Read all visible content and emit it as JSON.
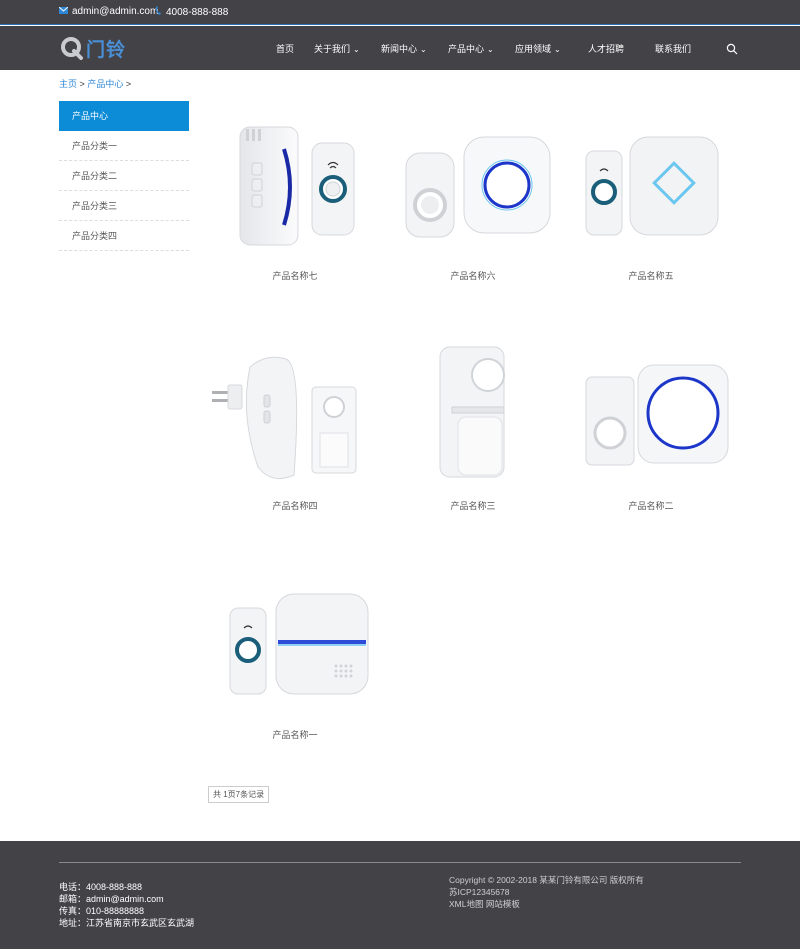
{
  "topbar": {
    "email": "admin@admin.com",
    "phone": "4008-888-888"
  },
  "logo": {
    "text": "门铃"
  },
  "nav": {
    "items": [
      {
        "label": "首页",
        "dropdown": false
      },
      {
        "label": "关于我们",
        "dropdown": true
      },
      {
        "label": "新闻中心",
        "dropdown": true
      },
      {
        "label": "产品中心",
        "dropdown": true
      },
      {
        "label": "应用领域",
        "dropdown": true
      },
      {
        "label": "人才招聘",
        "dropdown": false
      },
      {
        "label": "联系我们",
        "dropdown": false
      }
    ]
  },
  "breadcrumb": {
    "home": "主页",
    "sep": ">",
    "current": "产品中心",
    "trail_end": ">"
  },
  "sidebar": {
    "title": "产品中心",
    "items": [
      "产品分类一",
      "产品分类二",
      "产品分类三",
      "产品分类四"
    ]
  },
  "products": [
    {
      "name": "产品名称七"
    },
    {
      "name": "产品名称六"
    },
    {
      "name": "产品名称五"
    },
    {
      "name": "产品名称四"
    },
    {
      "name": "产品名称三"
    },
    {
      "name": "产品名称二"
    },
    {
      "name": "产品名称一"
    }
  ],
  "pager": {
    "text": "共 1页7条记录"
  },
  "footer": {
    "phone": "电话：4008-888-888",
    "email": "邮箱：admin@admin.com",
    "fax": "传真：010-88888888",
    "address": "地址：江苏省南京市玄武区玄武湖",
    "copyright": "Copyright © 2002-2018 某某门铃有限公司 版权所有",
    "icp": "苏ICP12345678",
    "links": "XML地图 网站模板"
  },
  "colors": {
    "header_bg": "#434247",
    "accent": "#0c8bd6",
    "logo": "#4a8fd6"
  }
}
